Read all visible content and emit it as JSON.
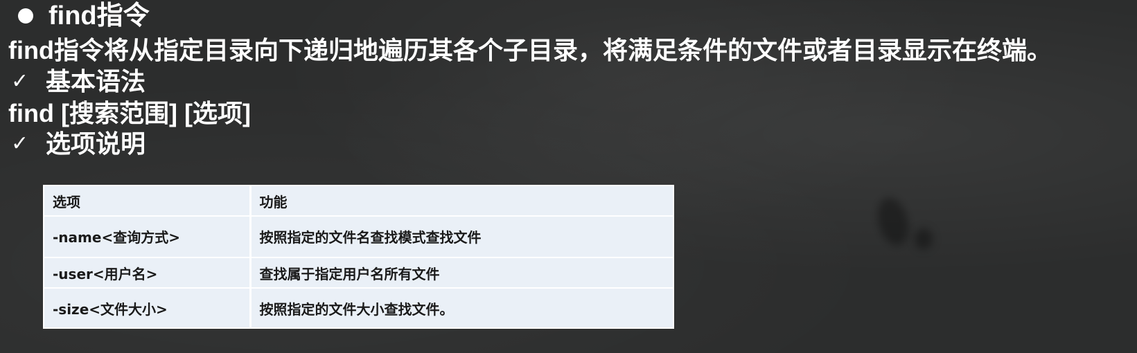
{
  "slide": {
    "title": "find指令",
    "description": "find指令将从指定目录向下递归地遍历其各个子目录，将满足条件的文件或者目录显示在终端。",
    "check_mark": "✓",
    "syntax_heading": "基本语法",
    "syntax": "find  [搜索范围]  [选项]",
    "options_heading": "选项说明"
  },
  "table": {
    "headers": [
      "选项",
      "功能"
    ],
    "rows": [
      {
        "option": "-name<查询方式>",
        "function": "按照指定的文件名查找模式查找文件"
      },
      {
        "option": "-user<用户名>",
        "function": "查找属于指定用户名所有文件"
      },
      {
        "option": "-size<文件大小>",
        "function": "按照指定的文件大小查找文件。"
      }
    ]
  },
  "colors": {
    "background": "#2c2d2d",
    "text": "#ffffff",
    "table_background": "#eaf0f7",
    "table_text": "#1a1a1a"
  }
}
